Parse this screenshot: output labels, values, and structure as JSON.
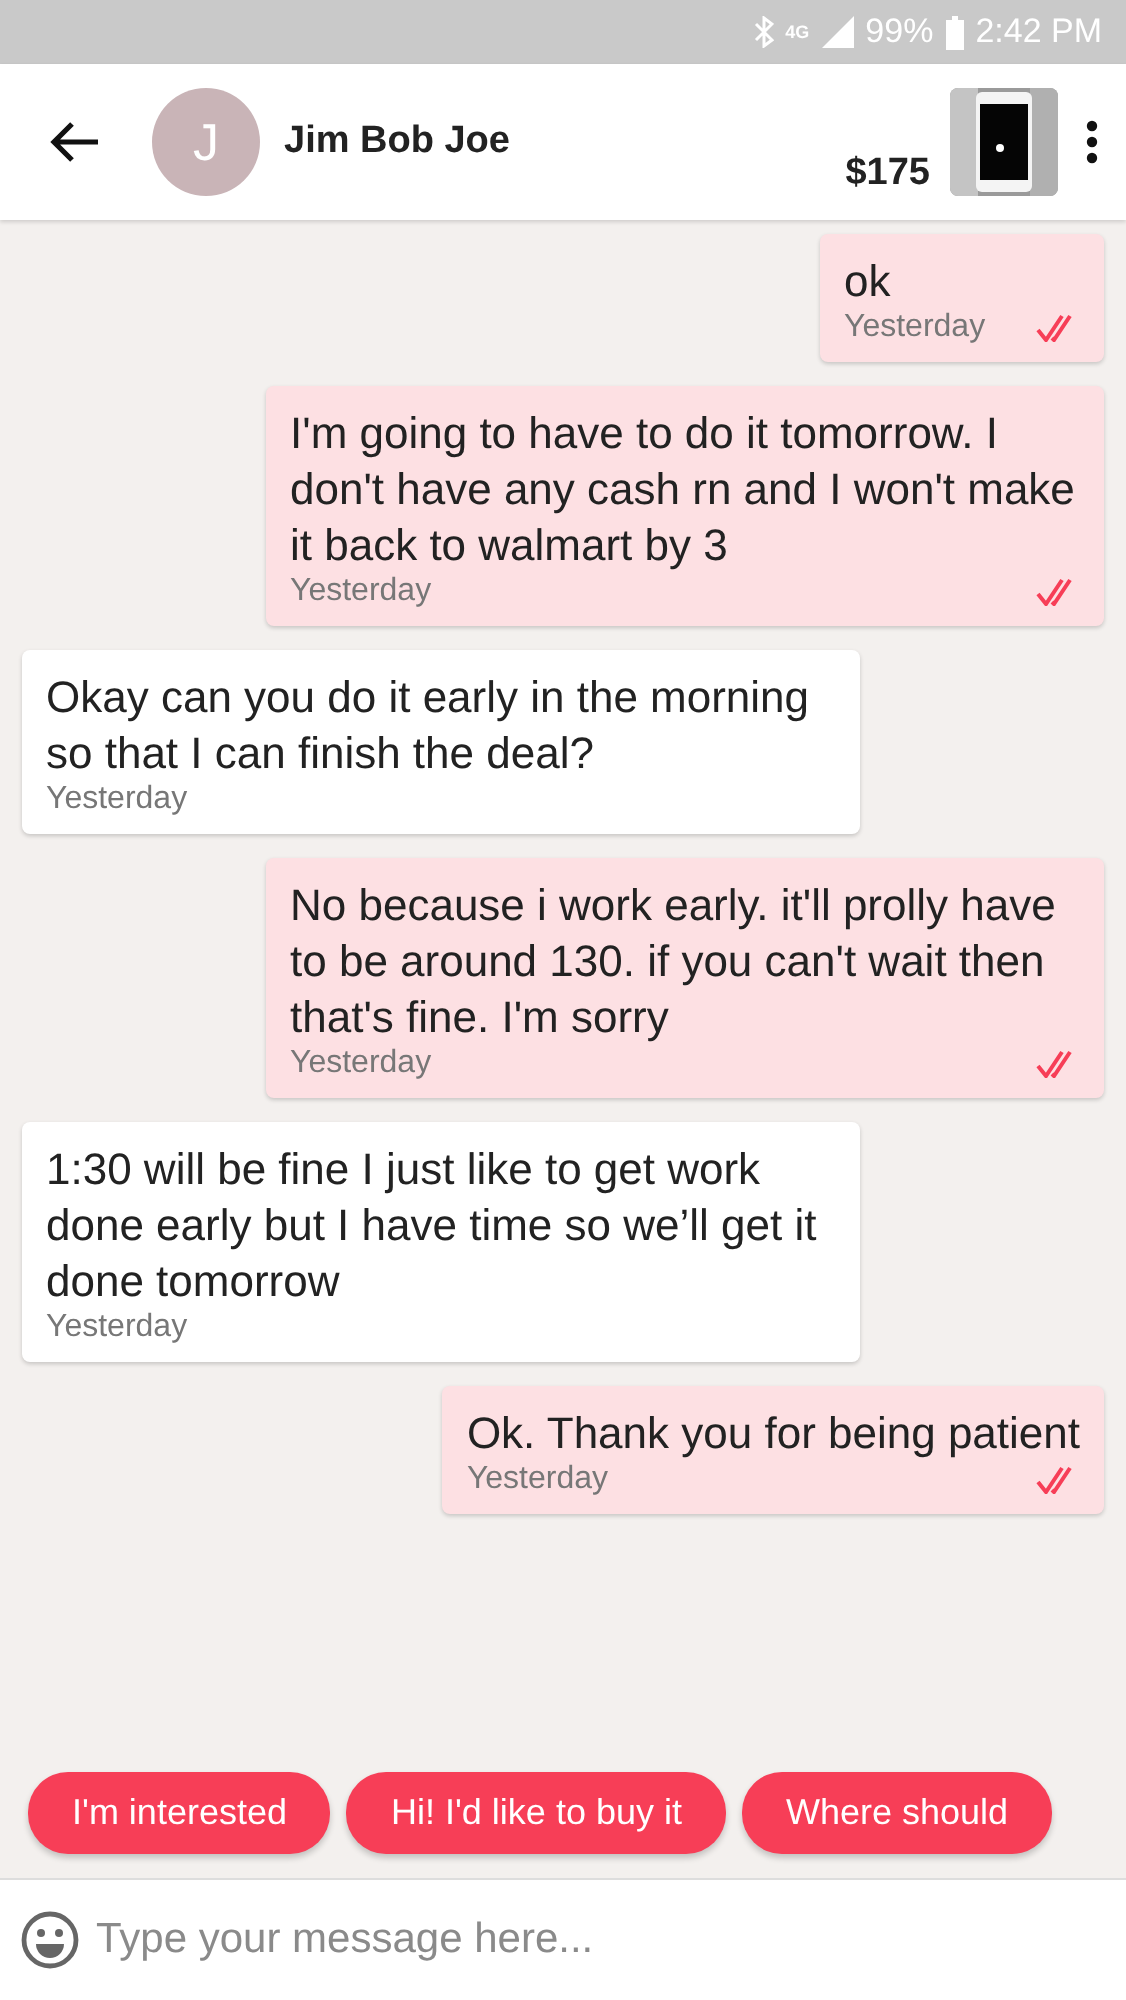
{
  "status_bar": {
    "network": "4G",
    "battery": "99%",
    "time": "2:42 PM"
  },
  "header": {
    "avatar_letter": "J",
    "name": "Jim Bob Joe",
    "price": "$175"
  },
  "messages": [
    {
      "kind": "outgoing",
      "text": "ok",
      "time": "Yesterday",
      "read": true
    },
    {
      "kind": "outgoing",
      "text": "I'm going to have to do it tomorrow. I don't have any cash rn and I won't make it back to walmart by 3",
      "time": "Yesterday",
      "read": true
    },
    {
      "kind": "incoming",
      "text": "Okay can you do it early in the morning so that I can finish the deal?",
      "time": "Yesterday"
    },
    {
      "kind": "outgoing",
      "text": "No because i work early. it'll prolly have to be around 130. if you can't wait then that's fine. I'm sorry",
      "time": "Yesterday",
      "read": true
    },
    {
      "kind": "incoming",
      "text": "1:30 will be fine I just like to get work done early but I have time so we’ll get it done tomorrow",
      "time": "Yesterday"
    },
    {
      "kind": "outgoing",
      "text": "Ok. Thank you for being patient",
      "time": "Yesterday",
      "read": true
    }
  ],
  "quick_replies": [
    "I'm interested",
    "Hi! I'd like to buy it",
    "Where should"
  ],
  "composer": {
    "placeholder": "Type your message here..."
  }
}
